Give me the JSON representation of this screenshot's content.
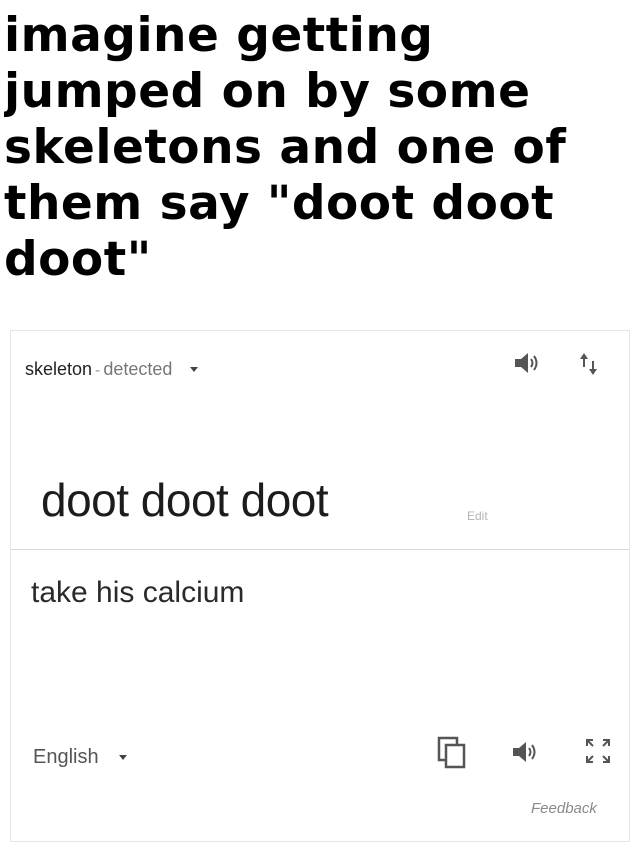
{
  "caption": {
    "text": "imagine getting\njumped on by some\nskeletons and one of\nthem say \"doot doot\ndoot\""
  },
  "translator": {
    "source": {
      "language": "skeleton",
      "separator": "-",
      "detected_label": "detected",
      "text": "doot doot doot",
      "edit_label": "Edit",
      "icons": [
        "speaker-icon",
        "swap-languages-icon",
        "dropdown-arrow-icon"
      ]
    },
    "target": {
      "text": "take his calcium",
      "language": "English",
      "feedback_label": "Feedback",
      "icons": [
        "copy-icon",
        "speaker-icon",
        "expand-icon",
        "dropdown-arrow-icon"
      ]
    }
  },
  "colors": {
    "text_primary": "#1c1c1c",
    "text_secondary": "#777777",
    "border": "#d9d9d9",
    "background": "#ffffff"
  }
}
